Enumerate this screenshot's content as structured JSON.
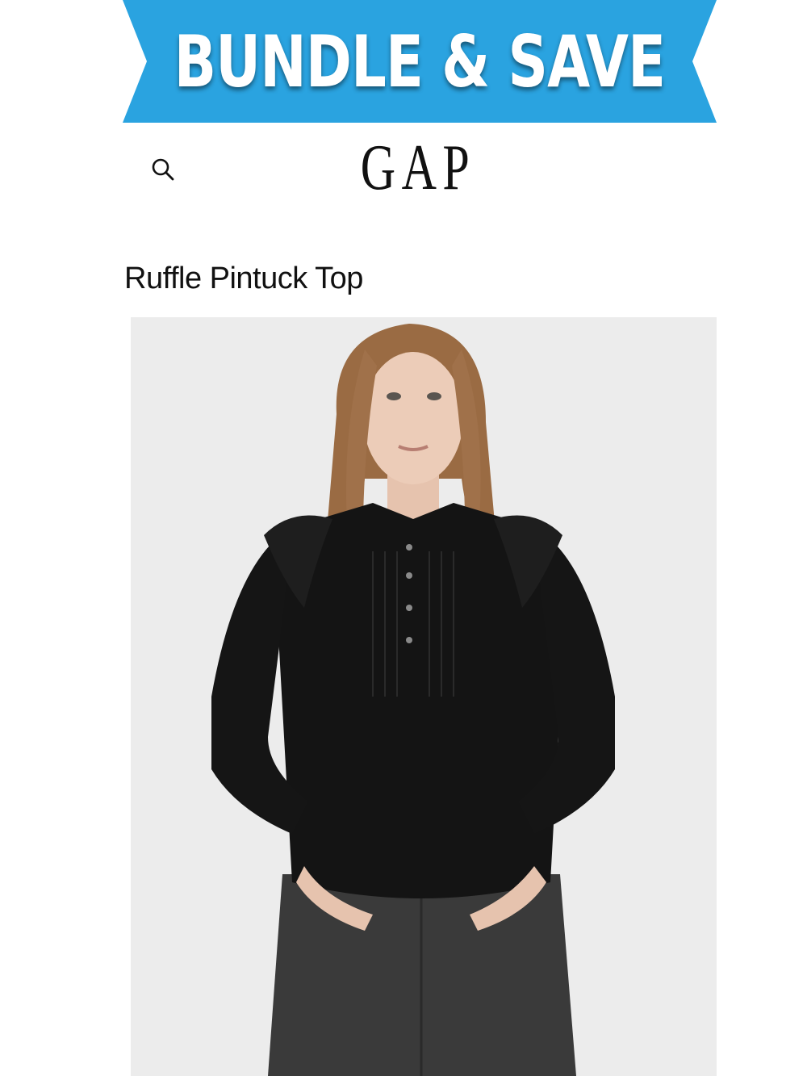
{
  "promo_banner": {
    "text": "BUNDLE & SAVE",
    "color": "#2aa3e0"
  },
  "header": {
    "brand": "GAP",
    "search_icon": "search-icon"
  },
  "product": {
    "title": "Ruffle Pintuck Top"
  }
}
